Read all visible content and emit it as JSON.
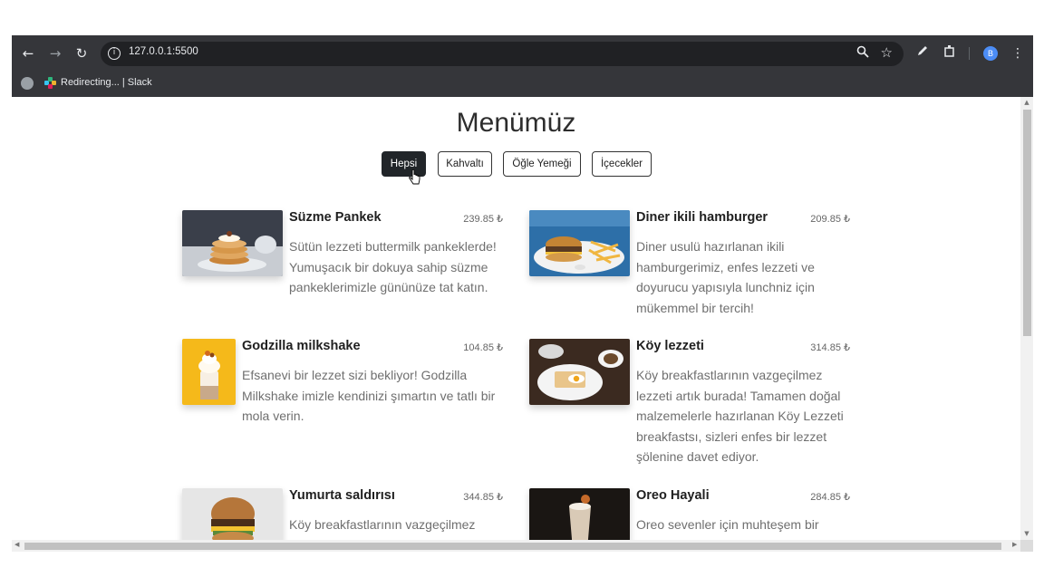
{
  "browser": {
    "url": "127.0.0.1:5500",
    "bookmark_label": "Redirecting... | Slack",
    "profile_initial": "B"
  },
  "page": {
    "title": "Menümüz",
    "filters": [
      "Hepsi",
      "Kahvaltı",
      "Öğle Yemeği",
      "İçecekler"
    ],
    "active_filter": "Hepsi"
  },
  "menu": [
    {
      "name": "Süzme Pankek",
      "price": "239.85 ₺",
      "description": "Sütün lezzeti buttermilk pankeklerde! Yumuşacık bir dokuya sahip süzme pankeklerimizle gününüze tat katın."
    },
    {
      "name": "Diner ikili hamburger",
      "price": "209.85 ₺",
      "description": "Diner usulü hazırlanan ikili hamburgerimiz, enfes lezzeti ve doyurucu yapısıyla lunchniz için mükemmel bir tercih!"
    },
    {
      "name": "Godzilla milkshake",
      "price": "104.85 ₺",
      "description": "Efsanevi bir lezzet sizi bekliyor! Godzilla Milkshake imizle kendinizi şımartın ve tatlı bir mola verin."
    },
    {
      "name": "Köy lezzeti",
      "price": "314.85 ₺",
      "description": "Köy breakfastlarının vazgeçilmez lezzeti artık burada! Tamamen doğal malzemelerle hazırlanan Köy Lezzeti breakfastsı, sizleri enfes bir lezzet şölenine davet ediyor."
    },
    {
      "name": "Yumurta saldırısı",
      "price": "344.85 ₺",
      "description": "Köy breakfastlarının vazgeçilmez"
    },
    {
      "name": "Oreo Hayali",
      "price": "284.85 ₺",
      "description": "Oreo sevenler için muhteşem bir"
    }
  ]
}
